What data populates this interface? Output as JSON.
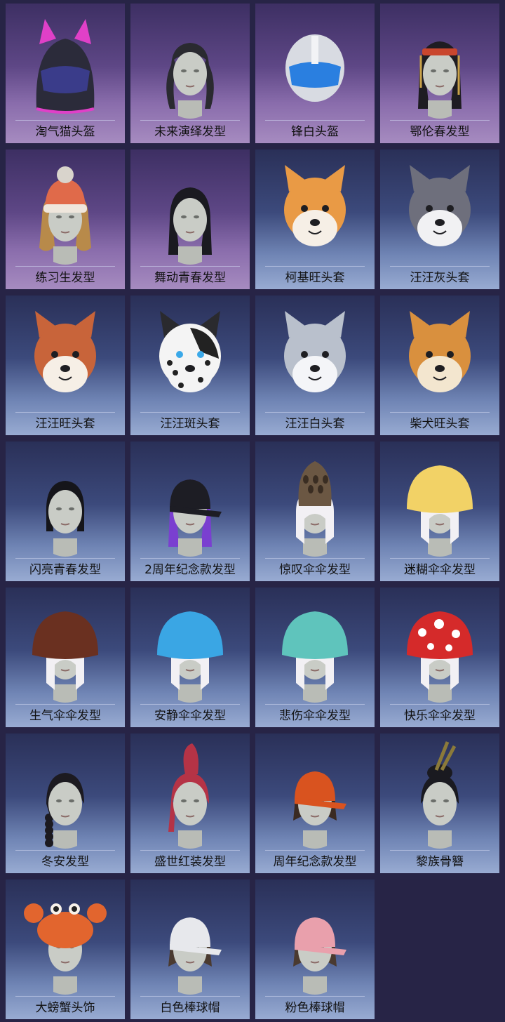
{
  "colors": {
    "page_bg": "#272446",
    "card_purple_top": "#3d2f63",
    "card_blue_top": "#2a3058",
    "label_text": "#111111"
  },
  "items": [
    {
      "label": "淘气猫头盔",
      "bg": "purple",
      "icon": "cat-helmet-icon",
      "hat": "cathelmet",
      "hair": "none",
      "c1": "#e040c8",
      "c2": "#2b2b3a"
    },
    {
      "label": "未来演绎发型",
      "bg": "purple",
      "icon": "future-hairstyle-icon",
      "hat": "none",
      "hair": "twintail",
      "c1": "#2a2a30",
      "c2": "#3fc3e8"
    },
    {
      "label": "锋白头盔",
      "bg": "purple",
      "icon": "white-helmet-icon",
      "hat": "helmet",
      "hair": "none",
      "c1": "#d8dbe2",
      "c2": "#2a7fe0"
    },
    {
      "label": "鄂伦春发型",
      "bg": "purple",
      "icon": "orochen-hairstyle-icon",
      "hat": "headband",
      "hair": "long",
      "c1": "#1e1c22",
      "c2": "#c9462e"
    },
    {
      "label": "练习生发型",
      "bg": "purple",
      "icon": "trainee-hairstyle-icon",
      "hat": "beanie",
      "hair": "curly",
      "c1": "#b88a4a",
      "c2": "#e06a4a"
    },
    {
      "label": "舞动青春发型",
      "bg": "purple",
      "icon": "dance-youth-hairstyle-icon",
      "hat": "none",
      "hair": "straight",
      "c1": "#1a1a20",
      "c2": "#1a1a20"
    },
    {
      "label": "柯基旺头套",
      "bg": "blue",
      "icon": "corgi-headgear-icon",
      "hat": "dog",
      "hair": "none",
      "c1": "#e99a45",
      "c2": "#f6efe6"
    },
    {
      "label": "汪汪灰头套",
      "bg": "blue",
      "icon": "gray-dog-headgear-icon",
      "hat": "dog",
      "hair": "none",
      "c1": "#6e6f7c",
      "c2": "#f1f1f3"
    },
    {
      "label": "汪汪旺头套",
      "bg": "blue",
      "icon": "red-dog-headgear-icon",
      "hat": "dog",
      "hair": "none",
      "c1": "#c8643a",
      "c2": "#f6efe6"
    },
    {
      "label": "汪汪斑头套",
      "bg": "blue",
      "icon": "spotted-dog-headgear-icon",
      "hat": "dog",
      "hair": "none",
      "c1": "#2a2a2e",
      "c2": "#f4f4f4"
    },
    {
      "label": "汪汪白头套",
      "bg": "blue",
      "icon": "white-dog-headgear-icon",
      "hat": "dog",
      "hair": "none",
      "c1": "#b9c0cc",
      "c2": "#f4f5f8"
    },
    {
      "label": "柴犬旺头套",
      "bg": "blue",
      "icon": "shiba-headgear-icon",
      "hat": "dog",
      "hair": "none",
      "c1": "#d9903e",
      "c2": "#f3e6cf"
    },
    {
      "label": "闪亮青春发型",
      "bg": "blue",
      "icon": "shiny-youth-hairstyle-icon",
      "hat": "none",
      "hair": "bob",
      "c1": "#15151a",
      "c2": "#15151a"
    },
    {
      "label": "2周年纪念款发型",
      "bg": "blue",
      "icon": "anniversary-cap-hairstyle-icon",
      "hat": "cap",
      "hair": "long",
      "c1": "#1d1d24",
      "c2": "#7a3fd0"
    },
    {
      "label": "惊叹伞伞发型",
      "bg": "blue",
      "icon": "morel-mushroom-hairstyle-icon",
      "hat": "morel",
      "hair": "none",
      "c1": "#6b5743",
      "c2": "#f2f0f4"
    },
    {
      "label": "迷糊伞伞发型",
      "bg": "blue",
      "icon": "yellow-mushroom-hairstyle-icon",
      "hat": "mushroom",
      "hair": "none",
      "c1": "#f2d266",
      "c2": "#f2f0f4"
    },
    {
      "label": "生气伞伞发型",
      "bg": "blue",
      "icon": "brown-mushroom-hairstyle-icon",
      "hat": "mushroom",
      "hair": "none",
      "c1": "#6a3020",
      "c2": "#f2f0f4"
    },
    {
      "label": "安静伞伞发型",
      "bg": "blue",
      "icon": "blue-mushroom-hairstyle-icon",
      "hat": "mushroom",
      "hair": "none",
      "c1": "#3aa6e4",
      "c2": "#f2f0f4"
    },
    {
      "label": "悲伤伞伞发型",
      "bg": "blue",
      "icon": "teal-mushroom-hairstyle-icon",
      "hat": "mushroom",
      "hair": "none",
      "c1": "#5fc4bc",
      "c2": "#f2f0f4"
    },
    {
      "label": "快乐伞伞发型",
      "bg": "blue",
      "icon": "red-mushroom-hairstyle-icon",
      "hat": "mushroom",
      "hair": "none",
      "c1": "#d52a2a",
      "c2": "#f2f0f4"
    },
    {
      "label": "冬安发型",
      "bg": "blue",
      "icon": "winter-hairstyle-icon",
      "hat": "none",
      "hair": "braid",
      "c1": "#1c1a20",
      "c2": "#1c1a20"
    },
    {
      "label": "盛世红装发型",
      "bg": "blue",
      "icon": "red-ponytail-hairstyle-icon",
      "hat": "none",
      "hair": "redpony",
      "c1": "#b53346",
      "c2": "#b53346"
    },
    {
      "label": "周年纪念款发型",
      "bg": "blue",
      "icon": "racing-cap-hairstyle-icon",
      "hat": "cap",
      "hair": "short",
      "c1": "#d9531f",
      "c2": "#3a2a22"
    },
    {
      "label": "黎族骨簪",
      "bg": "blue",
      "icon": "li-hairpin-icon",
      "hat": "pin",
      "hair": "bun",
      "c1": "#1a1a20",
      "c2": "#8b7a3a"
    },
    {
      "label": "大螃蟹头饰",
      "bg": "blue",
      "icon": "crab-headwear-icon",
      "hat": "crab",
      "hair": "none",
      "c1": "#e2652e",
      "c2": "#f7f1ea"
    },
    {
      "label": "白色棒球帽",
      "bg": "blue",
      "icon": "white-baseball-cap-icon",
      "hat": "cap",
      "hair": "short",
      "c1": "#e7e8ec",
      "c2": "#4a3a30"
    },
    {
      "label": "粉色棒球帽",
      "bg": "blue",
      "icon": "pink-baseball-cap-icon",
      "hat": "cap",
      "hair": "short",
      "c1": "#e9a0ac",
      "c2": "#4a3a30"
    }
  ]
}
